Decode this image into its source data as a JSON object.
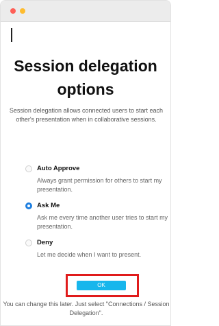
{
  "window": {
    "traffic_lights": [
      "close",
      "minimize"
    ]
  },
  "title": "Session delegation options",
  "description": "Session delegation allows connected users to start each other's presentation when in collaborative sessions.",
  "options": [
    {
      "label": "Auto Approve",
      "description": "Always grant permission for others to start my presentation.",
      "selected": false
    },
    {
      "label": "Ask Me",
      "description": "Ask me every time another user tries to start my presentation.",
      "selected": true
    },
    {
      "label": "Deny",
      "description": "Let me decide when I want to present.",
      "selected": false
    }
  ],
  "ok_button": {
    "label": "OK"
  },
  "footer": "You can change this later. Just select \"Connections / Session Delegation\".",
  "colors": {
    "accent": "#1e7fe0",
    "ok_button": "#17b6ec",
    "highlight": "#e01b1b",
    "close": "#ff5f57",
    "minimize": "#febc2e"
  }
}
